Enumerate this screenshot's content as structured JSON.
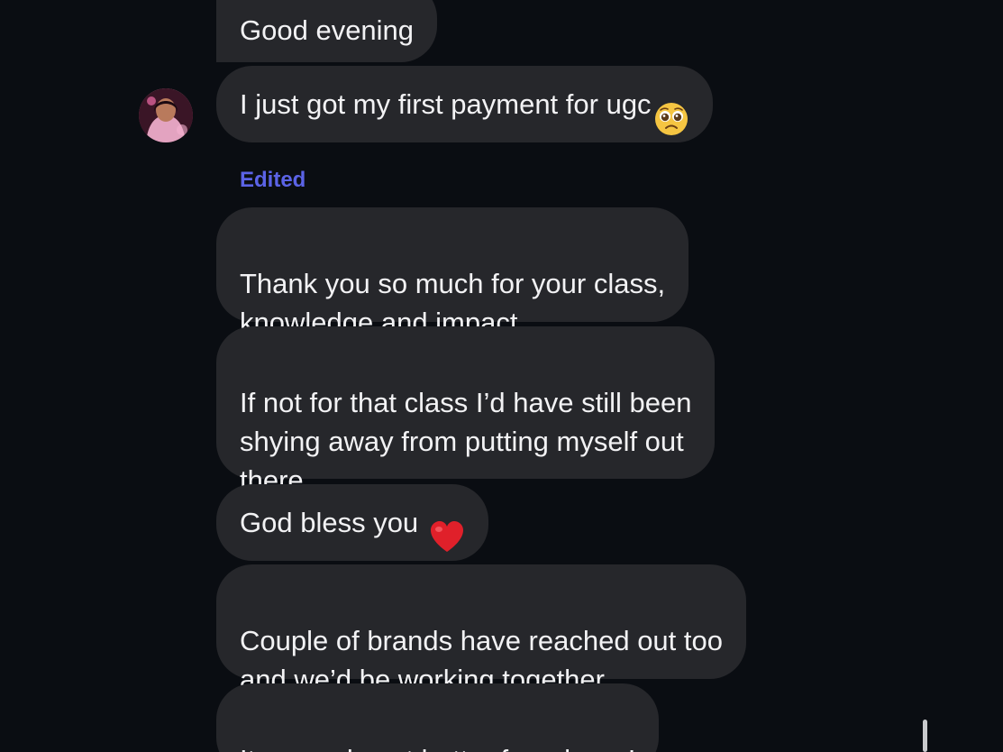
{
  "messages": [
    {
      "text": "Good evening"
    },
    {
      "text": "I just got my first payment for ugc",
      "emoji": "pleading-face-icon"
    },
    {
      "text": "Thank you so much for your class,\nknowledge and impact"
    },
    {
      "text": "If not for that class I’d have still been\nshying away from putting myself out\nthere"
    },
    {
      "text": "God bless you",
      "emoji": "red-heart-icon"
    },
    {
      "text": "Couple of brands have reached out too\nand we’d be working together"
    },
    {
      "text": "It can only get better from here !"
    }
  ],
  "edited_label": "Edited",
  "colors": {
    "background": "#0a0d12",
    "bubble": "#26272b",
    "text": "#f2f2f4",
    "edited": "#5b63e6",
    "heart": "#e0202a",
    "emoji_face": "#f5c542"
  }
}
